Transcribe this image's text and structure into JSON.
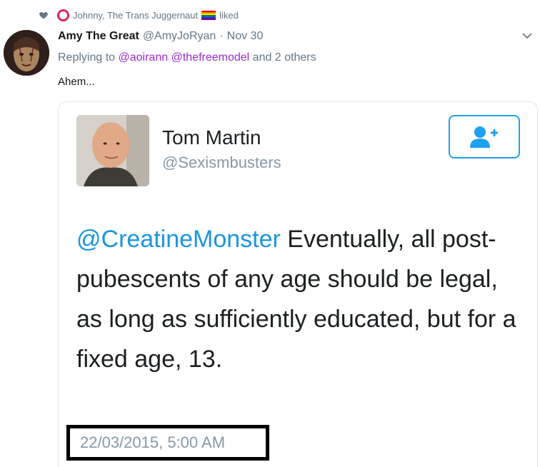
{
  "liked_banner": {
    "name": "Johnny, The Trans Juggernaut",
    "suffix": "liked",
    "icons": [
      "heart-icon",
      "ring-icon",
      "rainbow-flag-icon"
    ],
    "rainbow_colors": [
      "#e40303",
      "#ff8c00",
      "#ffed00",
      "#008026",
      "#004dff",
      "#750787"
    ]
  },
  "tweet": {
    "display_name": "Amy The Great",
    "handle": "@AmyJoRyan",
    "separator": "·",
    "date": "Nov 30",
    "reply": {
      "prefix": "Replying to ",
      "mention1": "@aoirann",
      "mention2": "@thefreemodel",
      "suffix": " and 2 others"
    },
    "text": "Ahem..."
  },
  "quoted": {
    "display_name": "Tom Martin",
    "handle": "@Sexismbusters",
    "mention": "@CreatineMonster",
    "text": " Eventually, all post-pubescents of any age should be legal, as long as sufficiently educated, but for a fixed age, 13.",
    "timestamp": "22/03/2015, 5:00 AM",
    "follow_icon": "add-user-icon"
  },
  "colors": {
    "twitter_blue": "#1da1f2",
    "mention_blue": "#1b95e0",
    "mention_purple": "#9b2bd0",
    "secondary_gray": "#657786",
    "like_red": "#e0245e"
  }
}
